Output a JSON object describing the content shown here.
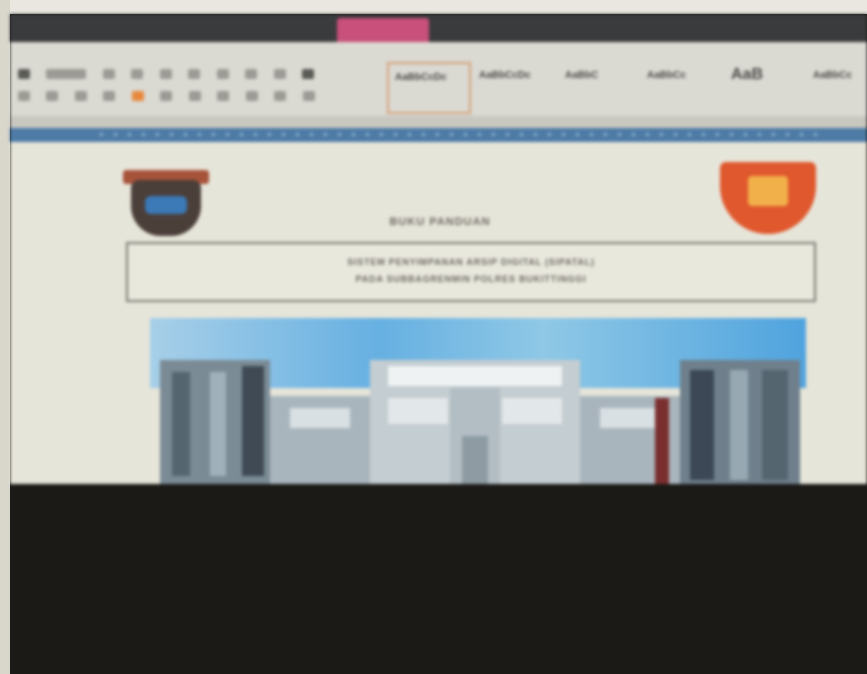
{
  "window": {
    "title": ""
  },
  "ribbon": {
    "tabs": [
      "",
      "",
      "",
      ""
    ],
    "context_tab_label": "",
    "styles": [
      {
        "preview": "AaBbCcDc",
        "name": ""
      },
      {
        "preview": "AaBbCcDc",
        "name": ""
      },
      {
        "preview": "AaBbC",
        "name": ""
      },
      {
        "preview": "AaBbCc",
        "name": ""
      },
      {
        "preview": "AaB",
        "name": ""
      },
      {
        "preview": "AaBbCc",
        "name": ""
      }
    ],
    "accent_color": "#e7893e"
  },
  "document": {
    "title": "BUKU PANDUAN",
    "subtitle_lines": [
      "SISTEM PENYIMPANAN ARSIP DIGITAL (SIPATAL)",
      "PADA SUBBAGRENMIN POLRES BUKITTINGGI"
    ],
    "left_logo": "police-emblem-icon",
    "right_logo": "regional-emblem-icon"
  },
  "colors": {
    "ruler": "#4d7ba6",
    "title_bar": "#3a3b3c",
    "context_tab": "#c8507a"
  }
}
